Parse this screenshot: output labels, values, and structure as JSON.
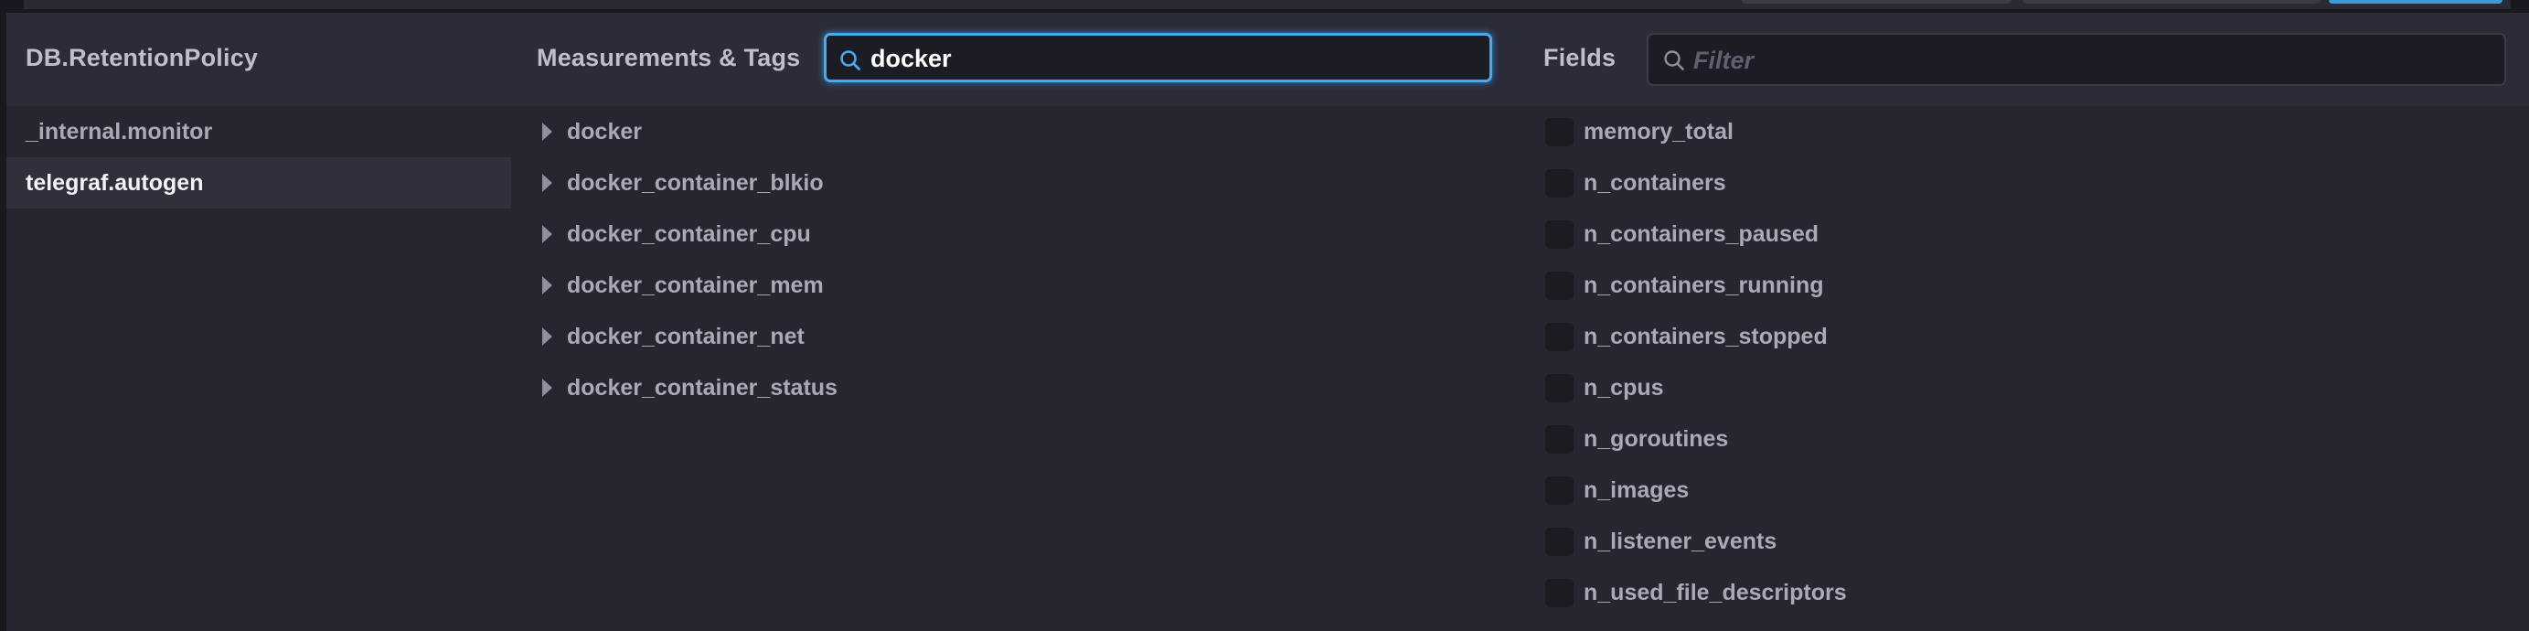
{
  "colors": {
    "background": "#262630",
    "header": "#2c2c38",
    "accent": "#4aa8ee",
    "text": "#a9a9b8",
    "text_active": "#f2f2f7"
  },
  "databases": {
    "title": "DB.RetentionPolicy",
    "items": [
      {
        "label": "_internal.monitor",
        "active": false
      },
      {
        "label": "telegraf.autogen",
        "active": true
      }
    ]
  },
  "measurements": {
    "title": "Measurements & Tags",
    "search": {
      "value": "docker",
      "icon": "search-icon"
    },
    "items": [
      {
        "label": "docker",
        "icon": "caret-right-icon"
      },
      {
        "label": "docker_container_blkio",
        "icon": "caret-right-icon"
      },
      {
        "label": "docker_container_cpu",
        "icon": "caret-right-icon"
      },
      {
        "label": "docker_container_mem",
        "icon": "caret-right-icon"
      },
      {
        "label": "docker_container_net",
        "icon": "caret-right-icon"
      },
      {
        "label": "docker_container_status",
        "icon": "caret-right-icon"
      }
    ]
  },
  "fields": {
    "title": "Fields",
    "filter": {
      "placeholder": "Filter",
      "value": "",
      "icon": "search-icon"
    },
    "items": [
      {
        "label": "memory_total",
        "checked": false
      },
      {
        "label": "n_containers",
        "checked": false
      },
      {
        "label": "n_containers_paused",
        "checked": false
      },
      {
        "label": "n_containers_running",
        "checked": false
      },
      {
        "label": "n_containers_stopped",
        "checked": false
      },
      {
        "label": "n_cpus",
        "checked": false
      },
      {
        "label": "n_goroutines",
        "checked": false
      },
      {
        "label": "n_images",
        "checked": false
      },
      {
        "label": "n_listener_events",
        "checked": false
      },
      {
        "label": "n_used_file_descriptors",
        "checked": false
      }
    ]
  }
}
